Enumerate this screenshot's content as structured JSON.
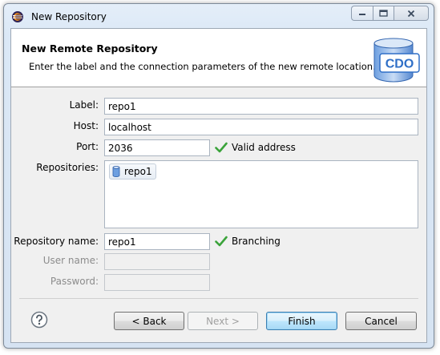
{
  "window": {
    "title": "New Repository"
  },
  "header": {
    "title": "New Remote Repository",
    "description": "Enter the label and the connection parameters of the new remote location.",
    "logo_text": "CDO"
  },
  "form": {
    "label": {
      "label": "Label:",
      "value": "repo1"
    },
    "host": {
      "label": "Host:",
      "value": "localhost"
    },
    "port": {
      "label": "Port:",
      "value": "2036",
      "status": "Valid address"
    },
    "repositories": {
      "label": "Repositories:",
      "items": [
        "repo1"
      ]
    },
    "repository_name": {
      "label": "Repository name:",
      "value": "repo1",
      "status": "Branching"
    },
    "user_name": {
      "label": "User name:",
      "value": ""
    },
    "password": {
      "label": "Password:",
      "value": ""
    }
  },
  "buttons": {
    "back": "< Back",
    "next": "Next >",
    "finish": "Finish",
    "cancel": "Cancel"
  },
  "colors": {
    "check": "#3aa33a",
    "logo_blue": "#2f6fc7",
    "default_button_border": "#3c7fb1"
  }
}
